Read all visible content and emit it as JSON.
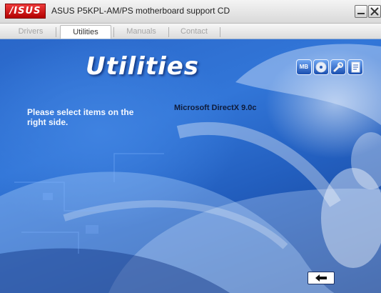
{
  "window": {
    "logo_text": "/ISUS",
    "title": "ASUS  P5KPL-AM/PS motherboard support CD",
    "controls": [
      "minimize",
      "close"
    ]
  },
  "tabs": [
    {
      "label": "Drivers",
      "active": false
    },
    {
      "label": "Utilities",
      "active": true
    },
    {
      "label": "Manuals",
      "active": false
    },
    {
      "label": "Contact",
      "active": false
    }
  ],
  "content": {
    "heading": "Utilities",
    "instruction": "Please select items on the right side.",
    "items": [
      "Microsoft DirectX 9.0c"
    ],
    "toolbar_icons": [
      {
        "name": "mb-info-icon",
        "text": "MB"
      },
      {
        "name": "cd-icon"
      },
      {
        "name": "wrench-icon"
      },
      {
        "name": "document-icon"
      }
    ],
    "back_icon": "left-arrow-icon"
  },
  "colors": {
    "background": "#2a67c9",
    "logo_red": "#d40000",
    "text_light": "#ffffff",
    "item_text": "#0e1b3a"
  }
}
